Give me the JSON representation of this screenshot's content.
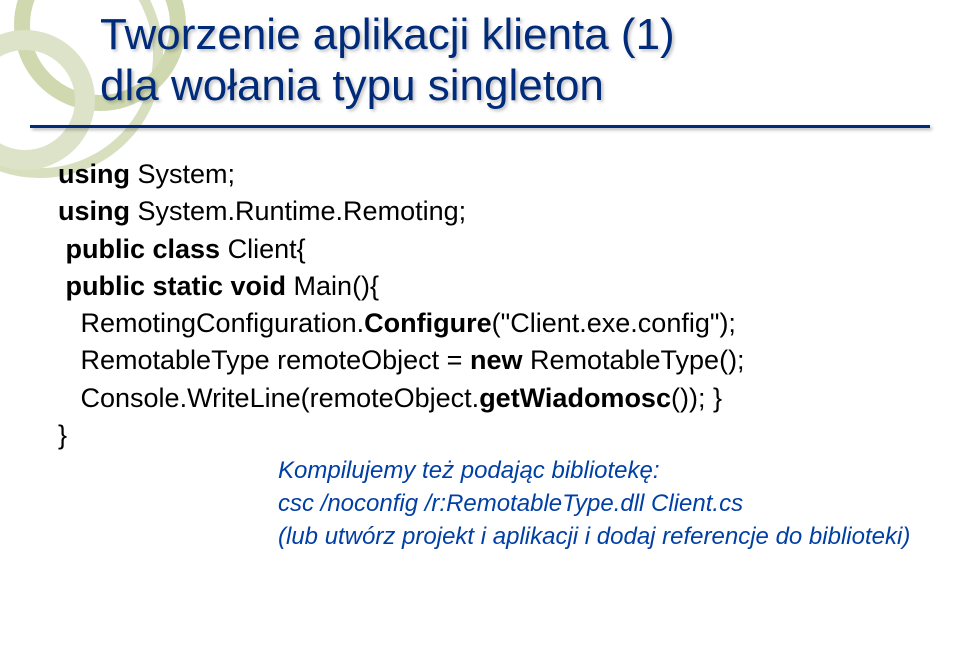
{
  "title": {
    "line1": "Tworzenie aplikacji klienta (1)",
    "line2": "dla wołania typu singleton"
  },
  "code": {
    "l1a": "using",
    "l1b": " System;",
    "l2a": "using",
    "l2b": " System.Runtime.Remoting;",
    "l3a": " public class",
    "l3b": " Client{",
    "l4a": " public static void",
    "l4b": " Main(){",
    "l5a": "   RemotingConfiguration.",
    "l5b": "Configure",
    "l5c": "(\"Client.exe.config\");",
    "l6a": "   RemotableType remoteObject = ",
    "l6b": "new",
    "l6c": " RemotableType();",
    "l7a": "   Console.WriteLine(remoteObject.",
    "l7b": "getWiadomosc",
    "l7c": "()); }",
    "l8": "}"
  },
  "note": {
    "n1": "Kompilujemy też podając bibliotekę:",
    "n2": "csc /noconfig /r:RemotableType.dll Client.cs",
    "n3": "(lub utwórz projekt i aplikacji i dodaj referencje do biblioteki)"
  }
}
